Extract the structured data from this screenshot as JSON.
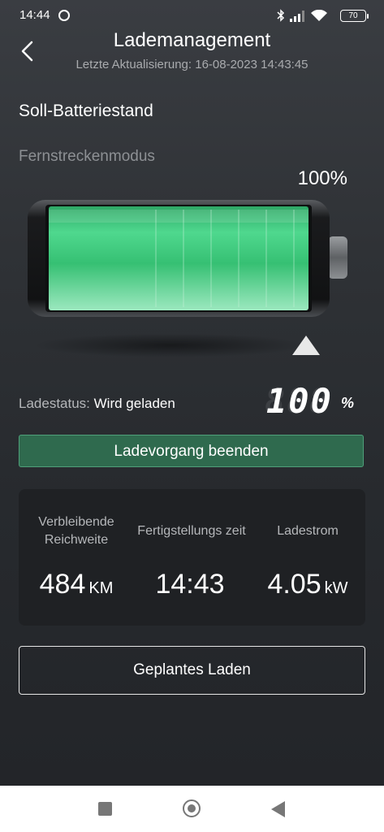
{
  "status_bar": {
    "time": "14:44",
    "battery_level": "70",
    "icons": [
      "bluetooth-icon",
      "signal-icon",
      "wifi-icon",
      "battery-icon"
    ]
  },
  "header": {
    "title": "Lademanagement",
    "subtitle": "Letzte Aktualisierung: 16-08-2023 14:43:45"
  },
  "target": {
    "section_title": "Soll-Batteriestand",
    "mode": "Fernstreckenmodus",
    "percent_label": "100%",
    "level_fraction": 1.0
  },
  "charging": {
    "status_label": "Ladestatus:",
    "status_value": "Wird geladen",
    "display_value": "100",
    "display_unit": "%",
    "stop_button": "Ladevorgang beenden"
  },
  "stats": [
    {
      "label": "Verbleibende Reichweite",
      "value": "484",
      "unit": "KM"
    },
    {
      "label": "Fertigstellungs zeit",
      "value": "14:43",
      "unit": ""
    },
    {
      "label": "Ladestrom",
      "value": "4.05",
      "unit": "kW"
    }
  ],
  "planned_button": "Geplantes Laden",
  "colors": {
    "accent_green": "#2f6a4e",
    "battery_green": "#3ec47a",
    "background": "#2f3236"
  }
}
